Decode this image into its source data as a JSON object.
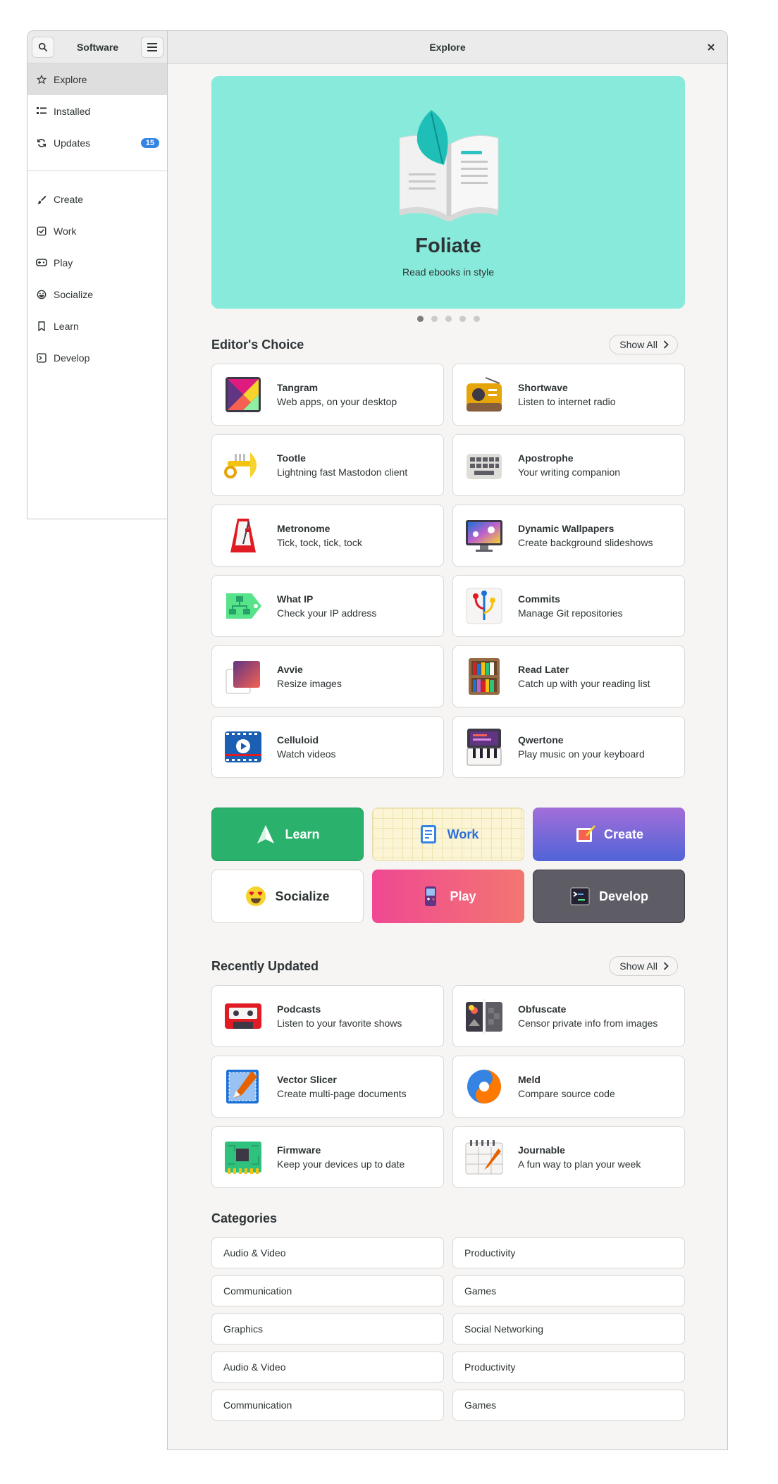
{
  "sidebar": {
    "title": "Software",
    "badge_updates": "15",
    "items": [
      {
        "label": "Explore"
      },
      {
        "label": "Installed"
      },
      {
        "label": "Updates"
      },
      {
        "label": "Create"
      },
      {
        "label": "Work"
      },
      {
        "label": "Play"
      },
      {
        "label": "Socialize"
      },
      {
        "label": "Learn"
      },
      {
        "label": "Develop"
      }
    ]
  },
  "main": {
    "title": "Explore",
    "banner": {
      "title": "Foliate",
      "subtitle": "Read ebooks in style",
      "bg_color": "#87eadb"
    },
    "editors_choice": {
      "title": "Editor's Choice",
      "show_all": "Show All",
      "apps": [
        {
          "name": "Tangram",
          "desc": "Web apps, on your desktop",
          "icon": "tangram-icon"
        },
        {
          "name": "Shortwave",
          "desc": "Listen to internet radio",
          "icon": "radio-icon"
        },
        {
          "name": "Tootle",
          "desc": "Lightning fast Mastodon client",
          "icon": "trumpet-icon"
        },
        {
          "name": "Apostrophe",
          "desc": "Your writing companion",
          "icon": "keyboard-icon"
        },
        {
          "name": "Metronome",
          "desc": "Tick, tock, tick, tock",
          "icon": "metronome-icon"
        },
        {
          "name": "Dynamic Wallpapers",
          "desc": "Create background slideshows",
          "icon": "monitor-icon"
        },
        {
          "name": "What IP",
          "desc": "Check your IP address",
          "icon": "network-tag-icon"
        },
        {
          "name": "Commits",
          "desc": "Manage Git repositories",
          "icon": "git-branch-icon"
        },
        {
          "name": "Avvie",
          "desc": "Resize images",
          "icon": "image-crop-icon"
        },
        {
          "name": "Read Later",
          "desc": "Catch up with your reading list",
          "icon": "bookshelf-icon"
        },
        {
          "name": "Celluloid",
          "desc": "Watch videos",
          "icon": "video-play-icon"
        },
        {
          "name": "Qwertone",
          "desc": "Play music on your keyboard",
          "icon": "piano-icon"
        }
      ]
    },
    "category_tiles": [
      {
        "label": "Learn"
      },
      {
        "label": "Work"
      },
      {
        "label": "Create"
      },
      {
        "label": "Socialize"
      },
      {
        "label": "Play"
      },
      {
        "label": "Develop"
      }
    ],
    "recently_updated": {
      "title": "Recently Updated",
      "show_all": "Show All",
      "apps": [
        {
          "name": "Podcasts",
          "desc": "Listen to your favorite shows",
          "icon": "cassette-icon"
        },
        {
          "name": "Obfuscate",
          "desc": "Censor private info from images",
          "icon": "obfuscate-icon"
        },
        {
          "name": "Vector Slicer",
          "desc": "Create multi-page documents",
          "icon": "vector-pen-icon"
        },
        {
          "name": "Meld",
          "desc": "Compare source code",
          "icon": "meld-swirl-icon"
        },
        {
          "name": "Firmware",
          "desc": "Keep your devices up to date",
          "icon": "chip-icon"
        },
        {
          "name": "Journable",
          "desc": "A fun way to plan your week",
          "icon": "planner-icon"
        }
      ]
    },
    "categories": {
      "title": "Categories",
      "items": [
        "Audio & Video",
        "Productivity",
        "Communication",
        "Games",
        "Graphics",
        "Social Networking",
        "Audio & Video",
        "Productivity",
        "Communication",
        "Games"
      ]
    },
    "colors": {
      "accent": "#3584e4",
      "learn": "#2ab16b",
      "develop": "#5e5c64",
      "play": "#f04893"
    }
  }
}
